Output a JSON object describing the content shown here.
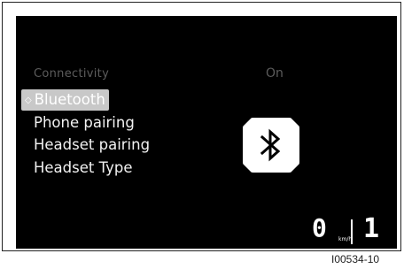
{
  "screen": {
    "header_label": "Connectivity",
    "header_value": "On",
    "menu": [
      {
        "label": "Bluetooth",
        "selected": true
      },
      {
        "label": "Phone pairing",
        "selected": false
      },
      {
        "label": "Headset pairing",
        "selected": false
      },
      {
        "label": "Headset Type",
        "selected": false
      }
    ],
    "selected_marker": "◇",
    "icon": "bluetooth-icon",
    "speed": "0",
    "speed_unit": "km/h",
    "gear": "1"
  },
  "figure_code": "I00534-10",
  "colors": {
    "background": "#000000",
    "highlight": "#c8c8c8",
    "dim_text": "#5c5c5c",
    "text": "#f2f2f2"
  }
}
